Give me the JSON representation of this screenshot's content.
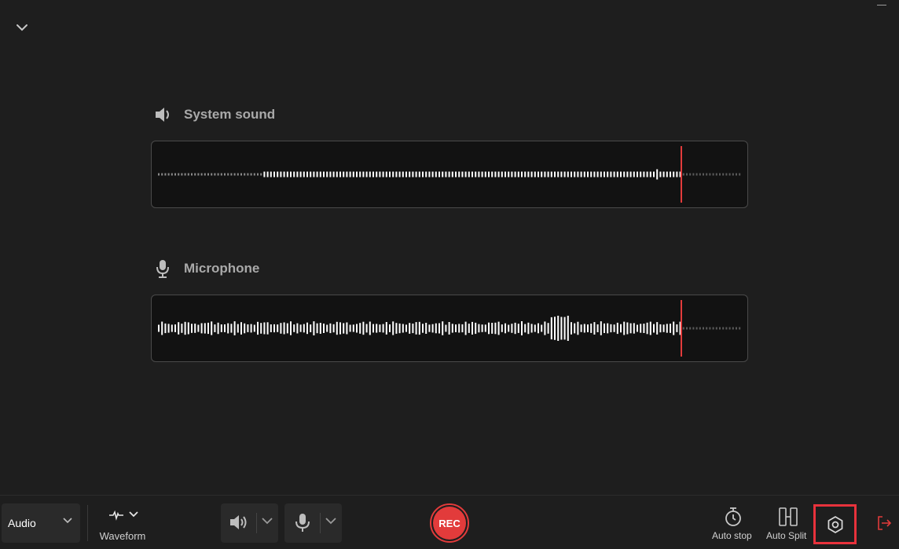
{
  "system_sound": {
    "title": "System sound",
    "icon": "speaker-icon",
    "progress": 0.9
  },
  "microphone": {
    "title": "Microphone",
    "icon": "microphone-icon",
    "progress": 0.9
  },
  "toolbar": {
    "mode": "Audio",
    "waveform_label": "Waveform",
    "rec_label": "REC",
    "auto_stop_label": "Auto stop",
    "auto_split_label": "Auto Split"
  },
  "colors": {
    "background": "#1e1e1e",
    "wave_bg": "#121212",
    "accent_red": "#e23b3b",
    "highlight_red": "#e8323c"
  }
}
